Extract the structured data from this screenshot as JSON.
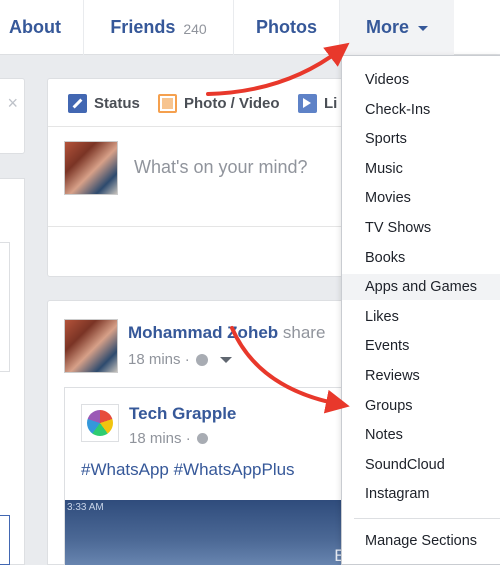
{
  "tabs": {
    "about": "About",
    "friends": "Friends",
    "friends_count": "240",
    "photos": "Photos",
    "more": "More"
  },
  "composer": {
    "status_label": "Status",
    "photo_label": "Photo / Video",
    "live_label": "Li",
    "placeholder": "What's on your mind?"
  },
  "post": {
    "author": "Mohammad Zoheb",
    "action": " share",
    "time": "18 mins ·",
    "shared": {
      "page_name": "Tech Grapple",
      "time": "18 mins ·",
      "text": "#WhatsApp #WhatsAppPlus",
      "image_time": "3:33 AM",
      "image_text": "En"
    }
  },
  "more_menu": {
    "items": [
      "Videos",
      "Check-Ins",
      "Sports",
      "Music",
      "Movies",
      "TV Shows",
      "Books",
      "Apps and Games",
      "Likes",
      "Events",
      "Reviews",
      "Groups",
      "Notes",
      "SoundCloud",
      "Instagram"
    ],
    "highlighted": "Apps and Games",
    "manage": "Manage Sections"
  },
  "colors": {
    "link": "#365899",
    "arrow": "#e8382b",
    "background": "#e9ebee"
  },
  "icons": {
    "close": "close-icon",
    "status": "pencil-icon",
    "photo": "photo-icon",
    "live": "live-video-icon",
    "privacy": "globe-icon",
    "dropdown": "chevron-down-icon"
  }
}
